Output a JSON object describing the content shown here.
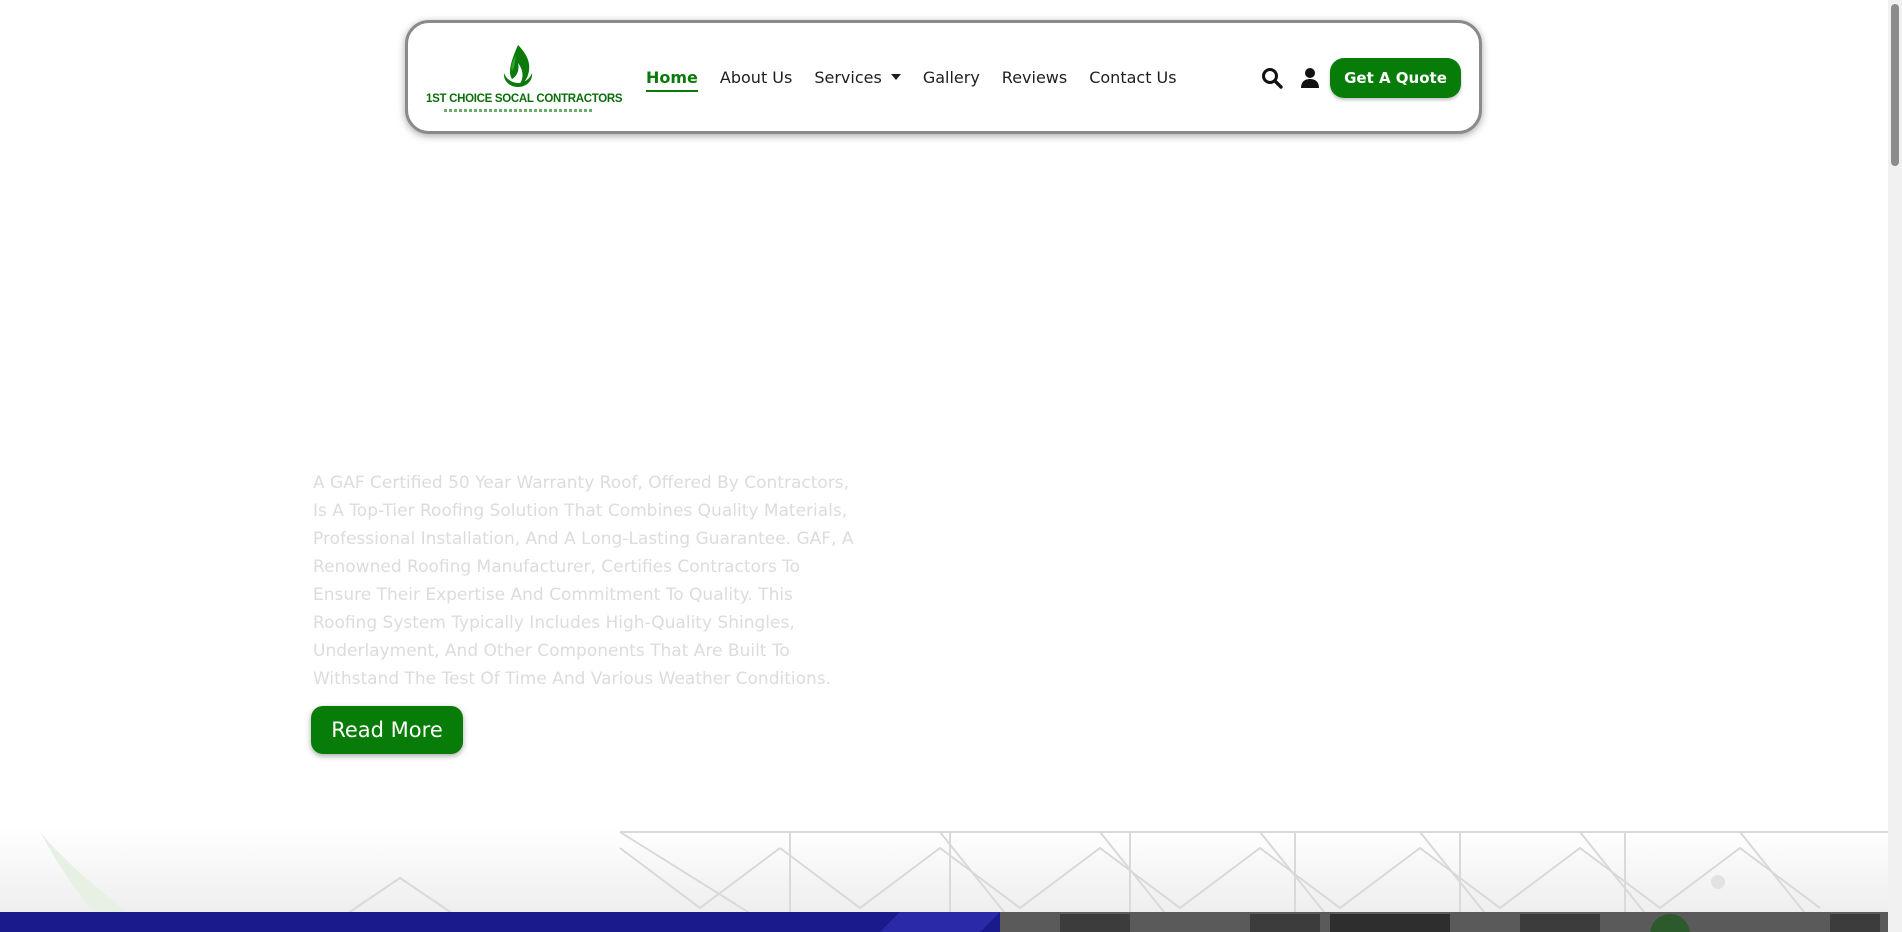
{
  "header": {
    "logo": {
      "text": "1ST CHOICE SOCAL CONTRACTORS",
      "icon": "green-flame-leaf-icon"
    },
    "nav": [
      {
        "label": "Home",
        "active": true
      },
      {
        "label": "About Us",
        "active": false
      },
      {
        "label": "Services",
        "active": false,
        "has_dropdown": true
      },
      {
        "label": "Gallery",
        "active": false
      },
      {
        "label": "Reviews",
        "active": false
      },
      {
        "label": "Contact Us",
        "active": false
      }
    ],
    "icons": [
      "search-icon",
      "user-icon"
    ],
    "quote_button": "Get A Quote"
  },
  "hero": {
    "paragraph": "A GAF Certified 50 Year Warranty Roof, Offered By Contractors, Is A Top-Tier Roofing Solution That Combines Quality Materials, Professional Installation, And A Long-Lasting Guarantee. GAF, A Renowned Roofing Manufacturer, Certifies Contractors To Ensure Their Expertise And Commitment To Quality. This Roofing System Typically Includes High-Quality Shingles, Underlayment, And Other Components That Are Built To Withstand The Test Of Time And Various Weather Conditions.",
    "read_more": "Read More"
  },
  "colors": {
    "brand_green": "#087c08",
    "faded_text": "#dcdcdc"
  }
}
